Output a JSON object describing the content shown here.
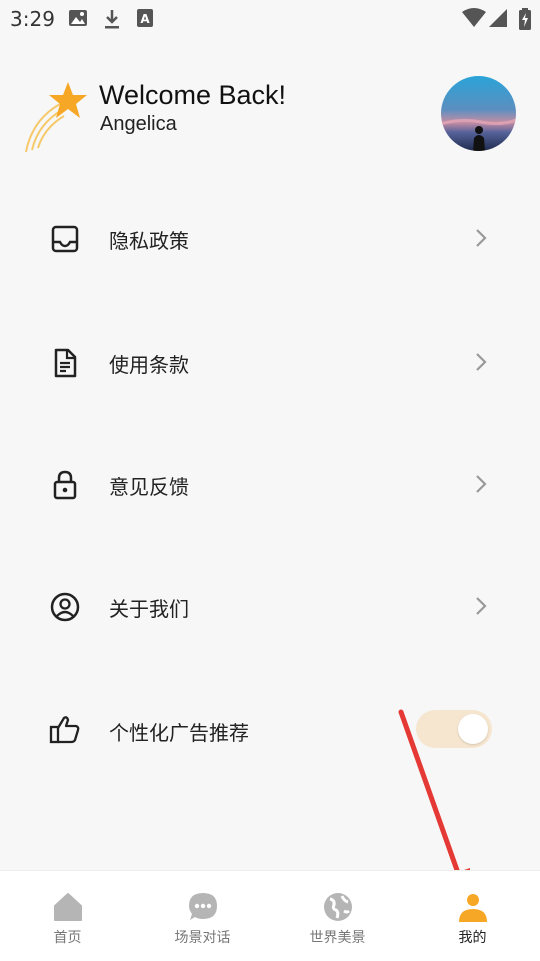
{
  "status_bar": {
    "time": "3:29"
  },
  "header": {
    "welcome": "Welcome Back!",
    "username": "Angelica"
  },
  "menu": [
    {
      "label": "隐私政策",
      "icon": "inbox-icon"
    },
    {
      "label": "使用条款",
      "icon": "document-icon"
    },
    {
      "label": "意见反馈",
      "icon": "lock-icon"
    },
    {
      "label": "关于我们",
      "icon": "user-circle-icon"
    }
  ],
  "ad_setting": {
    "label": "个性化广告推荐",
    "icon": "thumbs-up-icon",
    "enabled": true
  },
  "nav": [
    {
      "label": "首页",
      "icon": "home-icon"
    },
    {
      "label": "场景对话",
      "icon": "chat-icon"
    },
    {
      "label": "世界美景",
      "icon": "globe-icon"
    },
    {
      "label": "我的",
      "icon": "profile-icon",
      "active": true
    }
  ],
  "colors": {
    "accent": "#f6a726",
    "toggle_track": "#f6e6cf",
    "annotation_arrow": "#e53935"
  }
}
